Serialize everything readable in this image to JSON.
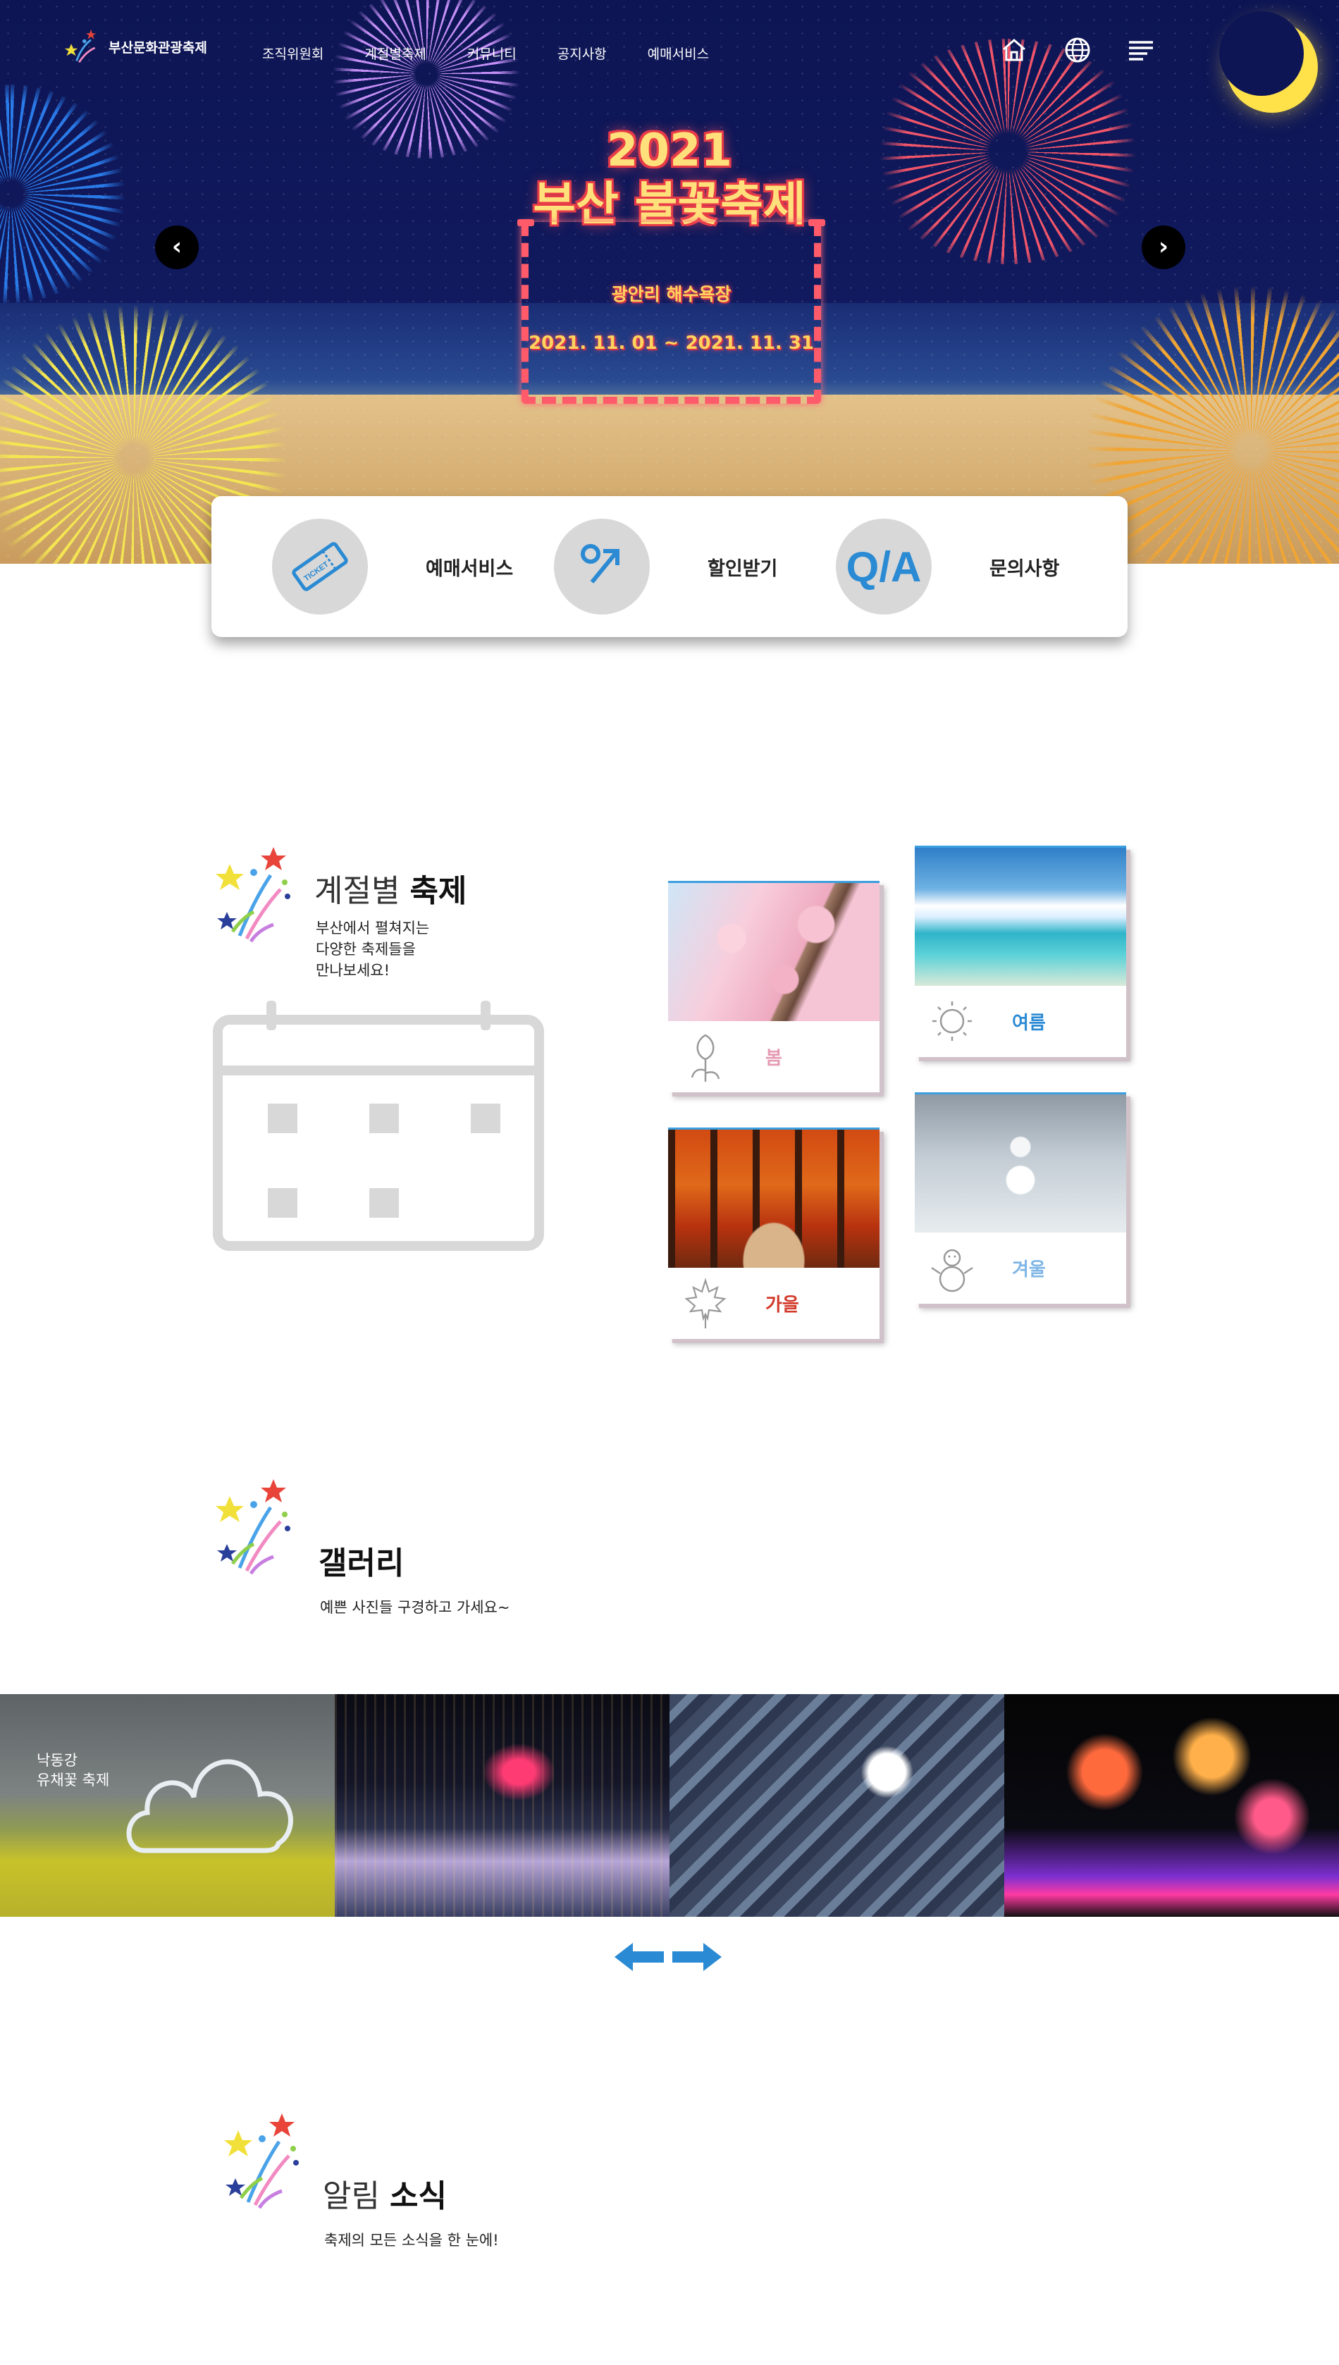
{
  "header": {
    "logo_text": "부산문화관광축제",
    "nav": [
      "조직위원회",
      "계절별축제",
      "커뮤니티",
      "공지사항",
      "예매서비스"
    ],
    "icons": [
      "home-icon",
      "globe-icon",
      "menu-icon"
    ]
  },
  "hero": {
    "year": "2021",
    "title": "부산 불꽃축제",
    "venue": "광안리 해수욕장",
    "dates": "2021. 11. 01 ~ 2021. 11. 31",
    "prev_label": "‹",
    "next_label": "›"
  },
  "quick_menu": {
    "items": [
      {
        "label": "예매서비스",
        "icon": "ticket-icon"
      },
      {
        "label": "할인받기",
        "icon": "discount-icon"
      },
      {
        "label": "문의사항",
        "icon": "qa-icon",
        "icon_text": "Q/A"
      }
    ]
  },
  "seasons": {
    "title_light": "계절별",
    "title_bold": "축제",
    "subtitle_lines": [
      "부산에서 펼쳐지는",
      "다양한 축제들을",
      "만나보세요!"
    ],
    "cards": [
      {
        "label": "봄",
        "color": "#e59bb4",
        "icon": "flower-icon"
      },
      {
        "label": "여름",
        "color": "#2a8ad3",
        "icon": "sun-icon"
      },
      {
        "label": "가을",
        "color": "#d33a2a",
        "icon": "maple-leaf-icon"
      },
      {
        "label": "겨울",
        "color": "#7fb6e6",
        "icon": "snowman-icon"
      }
    ]
  },
  "gallery": {
    "title": "갤러리",
    "subtitle": "예쁜 사진들 구경하고 가세요~",
    "first_caption_lines": [
      "낙동강",
      "유채꽃 축제"
    ]
  },
  "news": {
    "title_light": "알림",
    "title_bold": "소식",
    "subtitle": "축제의 모든 소식을 한 눈에!"
  }
}
